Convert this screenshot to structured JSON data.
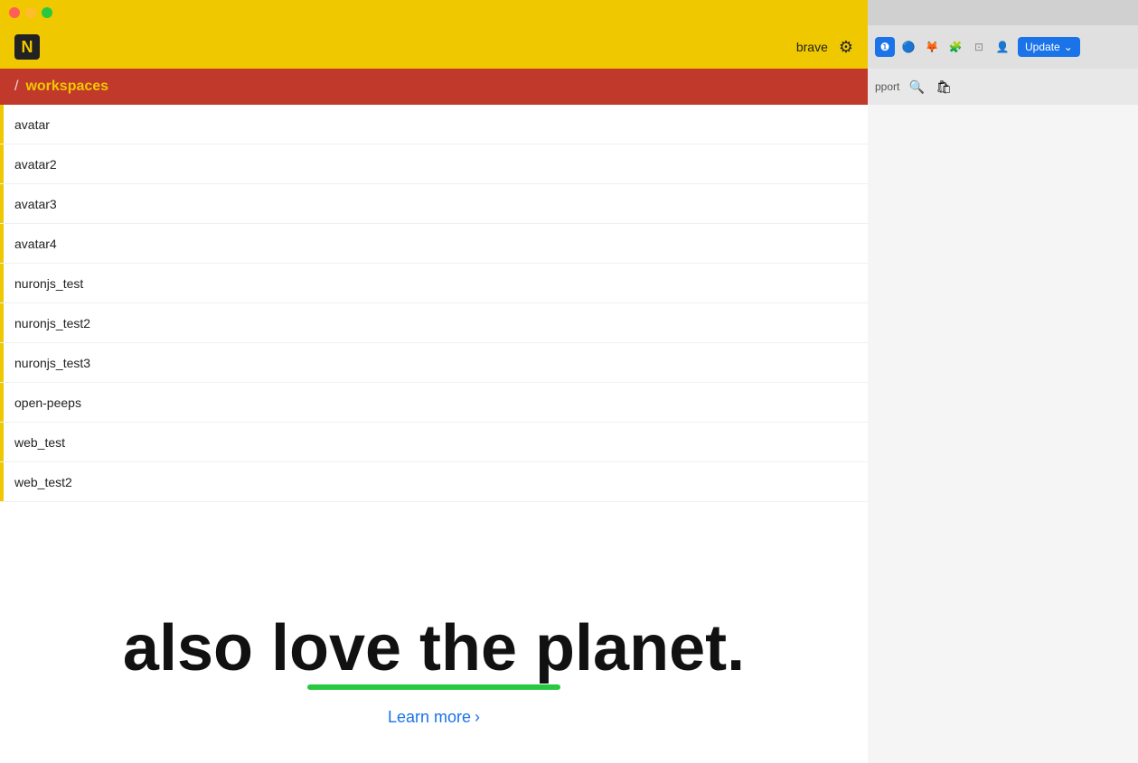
{
  "titlebar": {
    "traffic_lights": [
      "close",
      "minimize",
      "maximize"
    ]
  },
  "app_header": {
    "logo_text": "N",
    "username": "brave",
    "gear_icon": "⚙"
  },
  "breadcrumb": {
    "slash": "/",
    "workspaces_label": "workspaces"
  },
  "workspace_list": {
    "items": [
      {
        "id": "avatar",
        "label": "avatar"
      },
      {
        "id": "avatar2",
        "label": "avatar2"
      },
      {
        "id": "avatar3",
        "label": "avatar3"
      },
      {
        "id": "avatar4",
        "label": "avatar4"
      },
      {
        "id": "nuronjs_test",
        "label": "nuronjs_test"
      },
      {
        "id": "nuronjs_test2",
        "label": "nuronjs_test2"
      },
      {
        "id": "nuronjs_test3",
        "label": "nuronjs_test3"
      },
      {
        "id": "open-peeps",
        "label": "open-peeps"
      },
      {
        "id": "web_test",
        "label": "web_test"
      },
      {
        "id": "web_test2",
        "label": "web_test2"
      }
    ]
  },
  "browser_chrome": {
    "update_button_label": "Update",
    "support_text": "pport",
    "dropdown_icon": "⌄"
  },
  "page_content": {
    "hero_line1": "also love the planet.",
    "learn_more_label": "Learn more",
    "learn_more_chevron": "›"
  }
}
